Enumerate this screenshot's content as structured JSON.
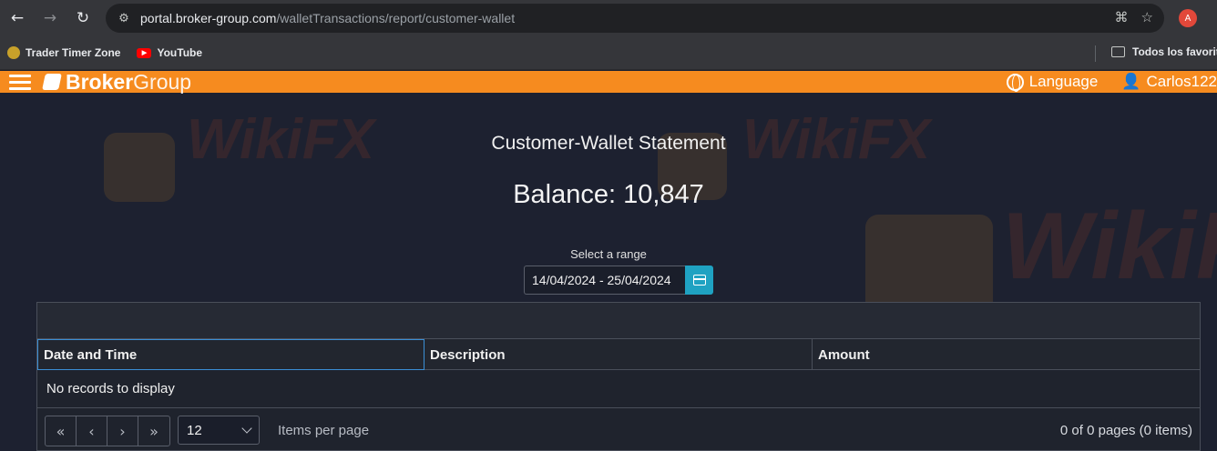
{
  "browser": {
    "url_host": "portal.broker-group.com",
    "url_path": "/walletTransactions/report/customer-wallet",
    "profile_initial": "A",
    "bookmarks": [
      {
        "label": "Trader Timer Zone"
      },
      {
        "label": "YouTube"
      }
    ],
    "bookmarks_folder": "Todos los favoritos"
  },
  "header": {
    "logo_bold": "Broker",
    "logo_light": "Group",
    "language_label": "Language",
    "user_label": "Carlos122",
    "accent": "#f68b1f"
  },
  "page": {
    "title": "Customer-Wallet Statement",
    "balance": "Balance: 10,847",
    "range_label": "Select a range",
    "range_value": "14/04/2024 - 25/04/2024"
  },
  "grid": {
    "columns": [
      "Date and Time",
      "Description",
      "Amount"
    ],
    "empty_message": "No records to display",
    "pager": {
      "page_size": "12",
      "items_per_page_label": "Items per page",
      "info": "0 of 0 pages (0 items)"
    }
  },
  "watermark": {
    "text": "WikiFX"
  }
}
